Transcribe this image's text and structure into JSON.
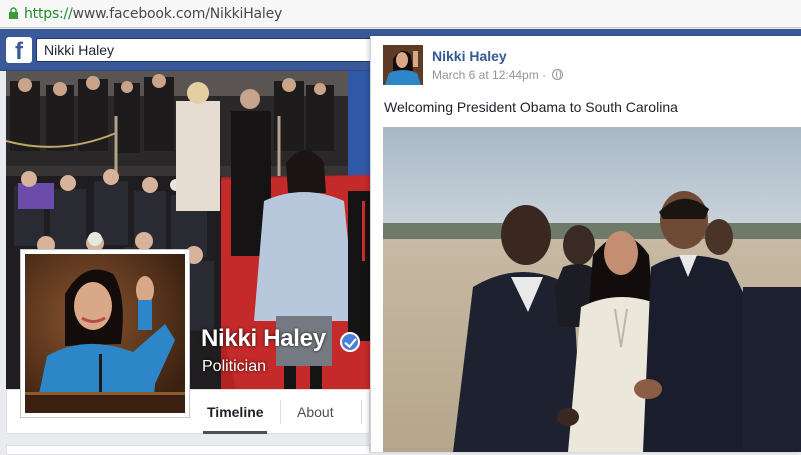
{
  "browser": {
    "url_scheme": "https://",
    "url_host": "www.facebook.com",
    "url_path": "/NikkiHaley"
  },
  "fb": {
    "logo": "f",
    "search_value": "Nikki Haley"
  },
  "profile": {
    "name": "Nikki Haley",
    "category": "Politician",
    "tabs": [
      "Timeline",
      "About"
    ]
  },
  "post": {
    "author": "Nikki Haley",
    "timestamp": "March 6 at 12:44pm",
    "separator": "·",
    "caption": "Welcoming President Obama to South Carolina"
  },
  "colors": {
    "fb_blue": "#3b5998",
    "link_blue": "#365899",
    "verified_blue": "#4b80d8"
  },
  "icons": [
    "lock-icon",
    "facebook-logo-icon",
    "verified-badge-icon",
    "globe-icon"
  ]
}
